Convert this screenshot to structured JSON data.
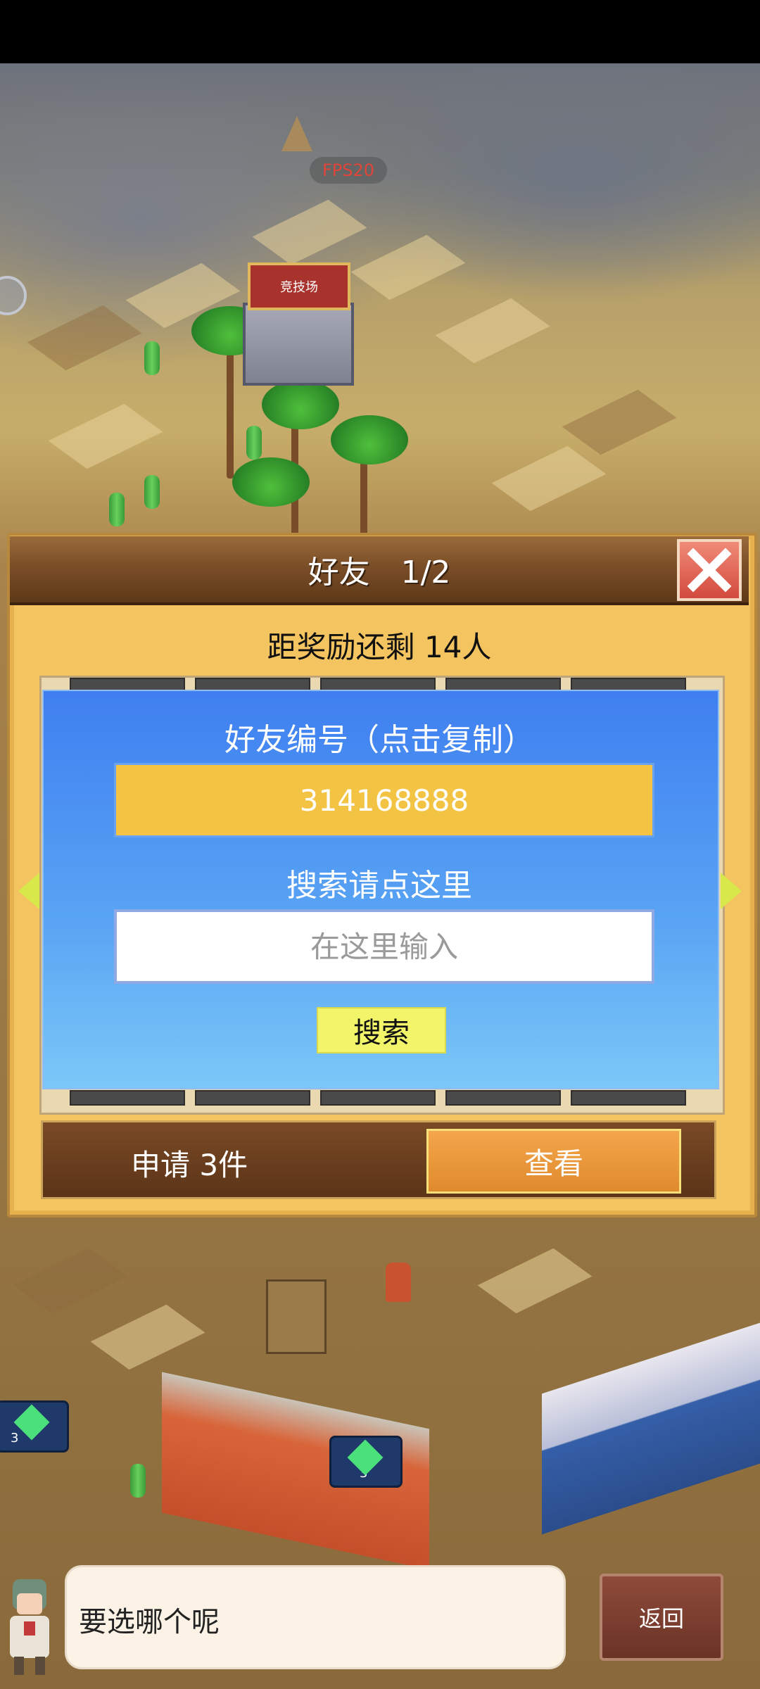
{
  "game": {
    "fps_label": "FPS20",
    "arena_sign": "竞技场"
  },
  "friends_panel": {
    "title": "好友　1/2",
    "reward_text": "距奖励还剩 14人",
    "friend_id_label": "好友编号（点击复制）",
    "friend_id": "314168888",
    "search_label": "搜索请点这里",
    "search_placeholder": "在这里输入",
    "search_button": "搜索",
    "request_text": "申请 3件",
    "view_button": "查看",
    "close_icon": "close-icon"
  },
  "village": {
    "gem_counts": [
      "3",
      "3"
    ]
  },
  "dialogue": {
    "text": "要选哪个呢",
    "back_button": "返回"
  },
  "colors": {
    "panel_gold": "#f3c45f",
    "card_blue": "#3f7ff0",
    "id_box_yellow": "#f3c443",
    "view_orange": "#f4a64a",
    "close_red": "#d24a3e"
  }
}
